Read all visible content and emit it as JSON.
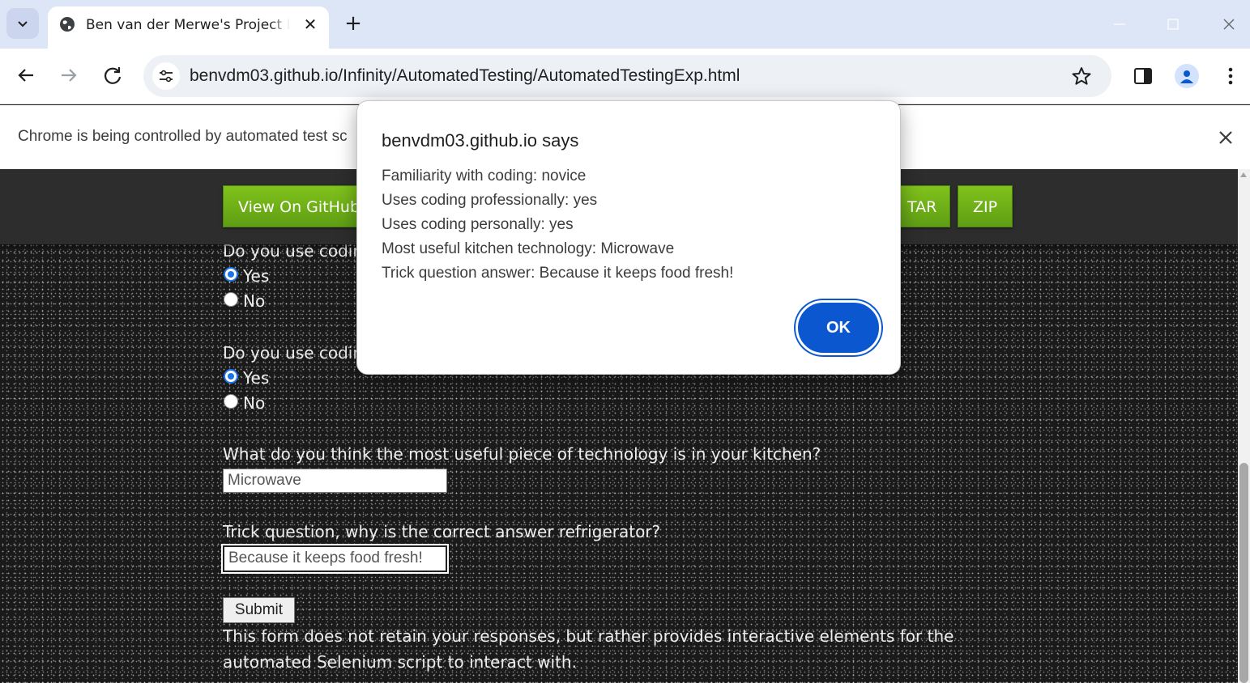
{
  "browser": {
    "tab": {
      "title": "Ben van der Merwe's Project R",
      "favicon": "globe-icon"
    },
    "url": "benvdm03.github.io/Infinity/AutomatedTesting/AutomatedTestingExp.html",
    "infobar_text": "Chrome is being controlled by automated test sc"
  },
  "header": {
    "view_github": "View On GitHub",
    "tar": "TAR",
    "zip": "ZIP"
  },
  "form": {
    "q_professional": "Do you use codin",
    "q_professional_opt_yes": "Yes",
    "q_professional_opt_no": "No",
    "q_personal": "Do you use codin",
    "q_personal_opt_yes": "Yes",
    "q_personal_opt_no": "No",
    "q_kitchen": "What do you think the most useful piece of technology is in your kitchen?",
    "kitchen_value": "Microwave",
    "q_trick": "Trick question, why is the correct answer refrigerator?",
    "trick_value": "Because it keeps food fresh!",
    "submit_label": "Submit",
    "note_line1": "This form does not retain your responses, but rather provides interactive elements for the",
    "note_line2": "automated Selenium script to interact with."
  },
  "dialog": {
    "title": "benvdm03.github.io says",
    "lines": [
      "Familiarity with coding: novice",
      "Uses coding professionally: yes",
      "Uses coding personally: yes",
      "Most useful kitchen technology: Microwave",
      "Trick question answer: Because it keeps food fresh!"
    ],
    "ok_label": "OK"
  },
  "colors": {
    "accent": "#0b57d0",
    "github_green": "#6fb21a",
    "tabstrip": "#dde6f6"
  }
}
